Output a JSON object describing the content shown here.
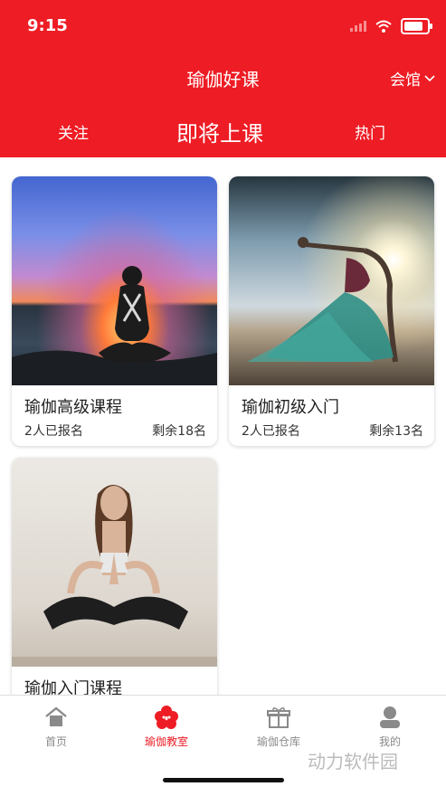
{
  "status": {
    "time": "9:15"
  },
  "header": {
    "title": "瑜伽好课",
    "venue": "会馆",
    "tabs": [
      "关注",
      "即将上课",
      "热门"
    ]
  },
  "courses": [
    {
      "name": "瑜伽高级课程",
      "enrolled": "2人已报名",
      "remaining": "剩余18名"
    },
    {
      "name": "瑜伽初级入门",
      "enrolled": "2人已报名",
      "remaining": "剩余13名"
    },
    {
      "name": "瑜伽入门课程"
    }
  ],
  "tabbar": {
    "items": [
      "首页",
      "瑜伽教室",
      "瑜伽仓库",
      "我的"
    ],
    "active_color": "#ee1c24",
    "inactive_color": "#8a8a8a"
  },
  "watermark": "动力软件园",
  "colors": {
    "brand": "#ee1c24"
  }
}
